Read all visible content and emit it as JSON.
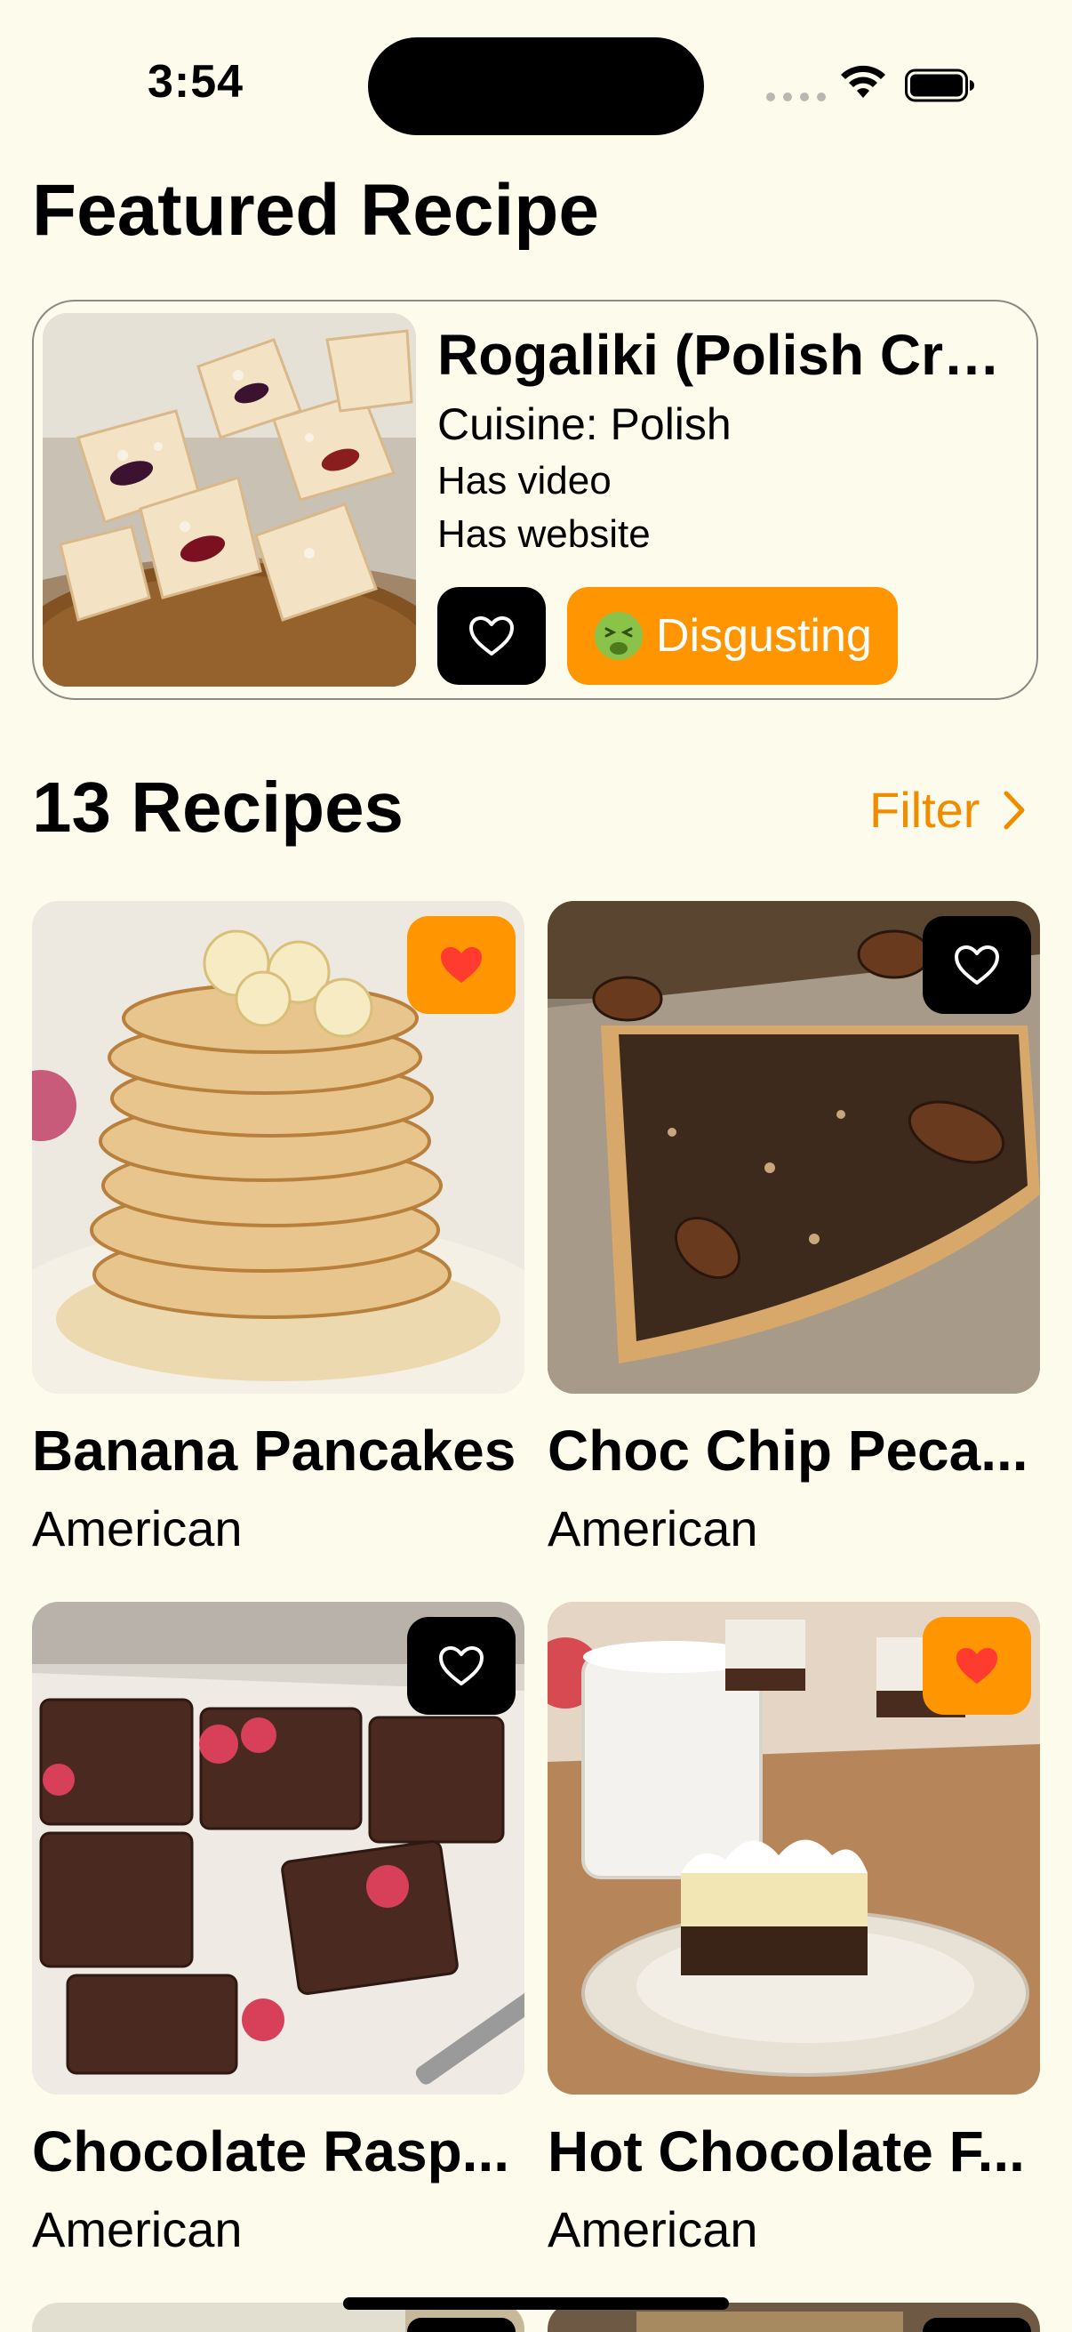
{
  "status_bar": {
    "time": "3:54"
  },
  "featured": {
    "heading": "Featured Recipe",
    "title": "Rogaliki (Polish Cro...",
    "cuisine": "Cuisine: Polish",
    "has_video": "Has video",
    "has_website": "Has website",
    "favorite": false,
    "rating_icon": "nauseated-face-emoji",
    "rating_label": "Disgusting"
  },
  "list": {
    "heading": "13 Recipes",
    "filter_label": "Filter"
  },
  "recipes": [
    {
      "title": "Banana Pancakes",
      "cuisine": "American",
      "favorite": true
    },
    {
      "title": "Choc Chip Peca...",
      "cuisine": "American",
      "favorite": false
    },
    {
      "title": "Chocolate Rasp...",
      "cuisine": "American",
      "favorite": false
    },
    {
      "title": "Hot Chocolate F...",
      "cuisine": "American",
      "favorite": true
    },
    {
      "title": "",
      "cuisine": "",
      "favorite": false
    },
    {
      "title": "",
      "cuisine": "",
      "favorite": false
    }
  ],
  "colors": {
    "background": "#FDFBEB",
    "accent": "#FF9500",
    "accent_text": "#F08C00",
    "heart_red": "#FF3B30"
  }
}
